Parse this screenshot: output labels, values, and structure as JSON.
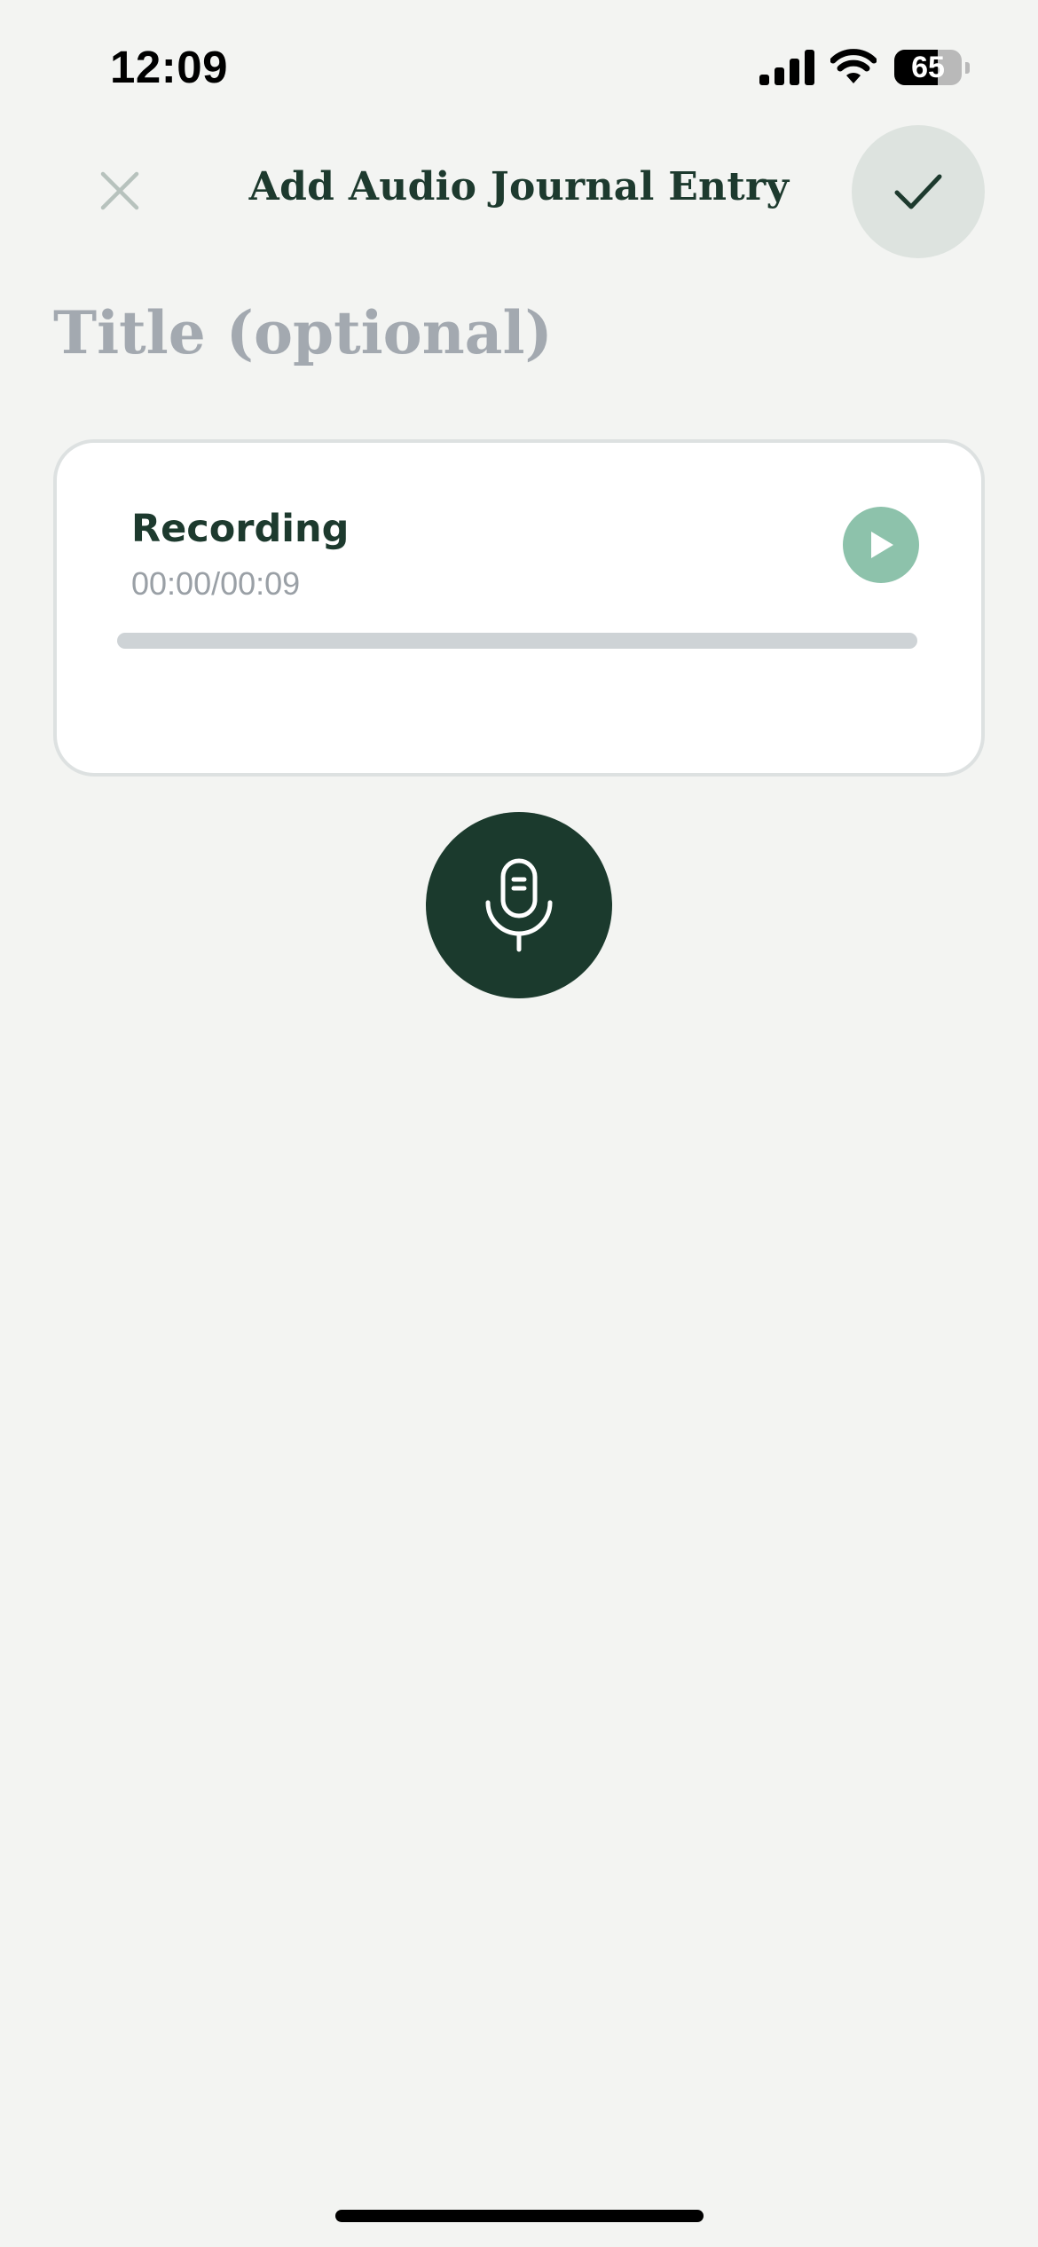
{
  "status_bar": {
    "time": "12:09",
    "battery_level": "65",
    "battery_fraction": 0.65
  },
  "header": {
    "title": "Add Audio Journal Entry",
    "close_icon": "close-icon",
    "confirm_icon": "checkmark-icon"
  },
  "form": {
    "title_placeholder": "Title (optional)",
    "title_value": ""
  },
  "recording": {
    "label": "Recording",
    "time_display": "00:00/00:09",
    "progress_fraction": 0,
    "play_icon": "play-icon"
  },
  "mic": {
    "icon": "microphone-icon"
  },
  "colors": {
    "background": "#f3f4f2",
    "primary_dark": "#1b3a2d",
    "accent_green": "#8dc2ab",
    "confirm_bg": "#dde3df",
    "muted_text": "#9aa0a6",
    "placeholder": "#a3a9b0"
  }
}
